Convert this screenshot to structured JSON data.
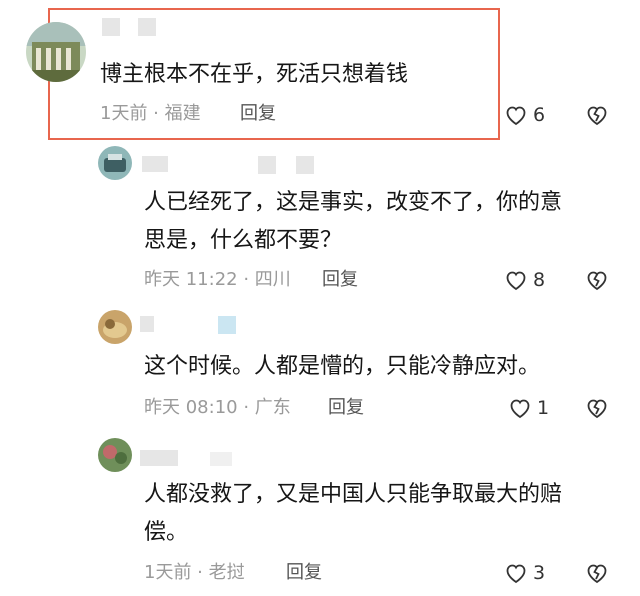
{
  "comments": [
    {
      "text_lines": [
        "博主根本不在乎，死活只想着钱"
      ],
      "meta": "1天前 · 福建",
      "reply": "回复",
      "likes": "6"
    },
    {
      "text_lines": [
        "人已经死了，这是事实，改变不了，你的意",
        "思是，什么都不要？"
      ],
      "meta": "昨天 11:22 · 四川",
      "reply": "回复",
      "likes": "8"
    },
    {
      "text_lines": [
        "这个时候。人都是懵的，只能冷静应对。"
      ],
      "meta": "昨天 08:10 · 广东",
      "reply": "回复",
      "likes": "1"
    },
    {
      "text_lines": [
        "人都没救了，又是中国人只能争取最大的赔",
        "偿。"
      ],
      "meta": "1天前 · 老挝",
      "reply": "回复",
      "likes": "3"
    }
  ],
  "colors": {
    "highlight_border": "#e8664e",
    "text": "#161616",
    "meta": "#9a9a9a"
  },
  "icons": {
    "like": "heart-outline-icon",
    "dislike": "broken-heart-icon"
  }
}
